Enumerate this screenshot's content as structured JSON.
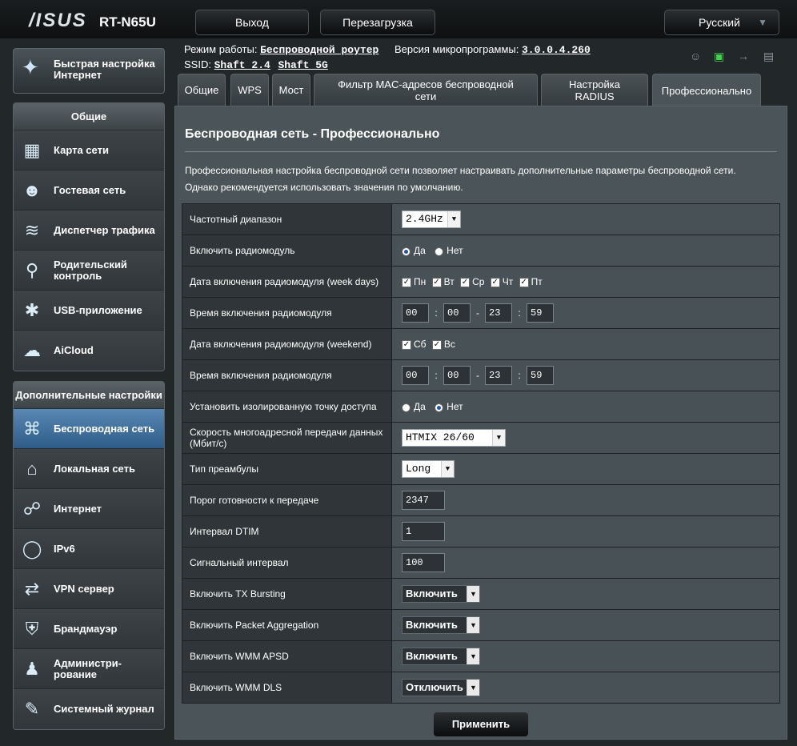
{
  "header": {
    "logo": "/ISUS",
    "model": "RT-N65U",
    "logout_label": "Выход",
    "reboot_label": "Перезагрузка",
    "language": "Русский"
  },
  "status": {
    "mode_label": "Режим работы:",
    "mode_value": "Беспроводной роутер",
    "firmware_label": "Версия микропрограммы:",
    "firmware_value": "3.0.0.4.260",
    "ssid_label": "SSID:",
    "ssid_24": "Shaft_2.4",
    "ssid_5": "Shaft_5G"
  },
  "sidebar": {
    "quick_setup": "Быстрая настройка Интернет",
    "general_title": "Общие",
    "general_items": [
      {
        "label": "Карта сети"
      },
      {
        "label": "Гостевая сеть"
      },
      {
        "label": "Диспетчер трафика"
      },
      {
        "label": "Родительский контроль"
      },
      {
        "label": "USB-приложение"
      },
      {
        "label": "AiCloud"
      }
    ],
    "advanced_title": "Дополнительные настройки",
    "advanced_items": [
      {
        "label": "Беспроводная сеть"
      },
      {
        "label": "Локальная сеть"
      },
      {
        "label": "Интернет"
      },
      {
        "label": "IPv6"
      },
      {
        "label": "VPN сервер"
      },
      {
        "label": "Брандмауэр"
      },
      {
        "label": "Администри-рование"
      },
      {
        "label": "Системный журнал"
      }
    ]
  },
  "tabs": [
    {
      "label": "Общие"
    },
    {
      "label": "WPS"
    },
    {
      "label": "Мост"
    },
    {
      "label": "Фильтр MAC-адресов беспроводной сети"
    },
    {
      "label": "Настройка RADIUS"
    },
    {
      "label": "Профессионально"
    }
  ],
  "page": {
    "title": "Беспроводная сеть - Профессионально",
    "desc1": "Профессиональная настройка беспроводной сети позволяет настраивать дополнительные параметры беспроводной сети.",
    "desc2": "Однако рекомендуется использовать значения по умолчанию."
  },
  "settings": {
    "band": {
      "label": "Частотный диапазон",
      "value": "2.4GHz"
    },
    "radio": {
      "label": "Включить радиомодуль",
      "yes": "Да",
      "no": "Нет"
    },
    "weekdays": {
      "label": "Дата включения радиомодуля (week days)",
      "days": [
        "Пн",
        "Вт",
        "Ср",
        "Чт",
        "Пт"
      ]
    },
    "weekday_time": {
      "label": "Время включения радиомодуля",
      "h1": "00",
      "m1": "00",
      "h2": "23",
      "m2": "59"
    },
    "weekend": {
      "label": "Дата включения радиомодуля (weekend)",
      "days": [
        "Сб",
        "Вс"
      ]
    },
    "weekend_time": {
      "label": "Время включения радиомодуля",
      "h1": "00",
      "m1": "00",
      "h2": "23",
      "m2": "59"
    },
    "isolate": {
      "label": "Установить изолированную точку доступа",
      "yes": "Да",
      "no": "Нет"
    },
    "multicast": {
      "label": "Скорость многоадресной передачи данных (Мбит/с)",
      "value": "HTMIX 26/60"
    },
    "preamble": {
      "label": "Тип преамбулы",
      "value": "Long"
    },
    "rts": {
      "label": "Порог готовности к передаче",
      "value": "2347"
    },
    "dtim": {
      "label": "Интервал DTIM",
      "value": "1"
    },
    "beacon": {
      "label": "Сигнальный интервал",
      "value": "100"
    },
    "tx_bursting": {
      "label": "Включить TX Bursting",
      "value": "Включить"
    },
    "packet_agg": {
      "label": "Включить Packet Aggregation",
      "value": "Включить"
    },
    "wmm_apsd": {
      "label": "Включить WMM APSD",
      "value": "Включить"
    },
    "wmm_dls": {
      "label": "Включить WMM DLS",
      "value": "Отключить"
    }
  },
  "apply_label": "Применить"
}
